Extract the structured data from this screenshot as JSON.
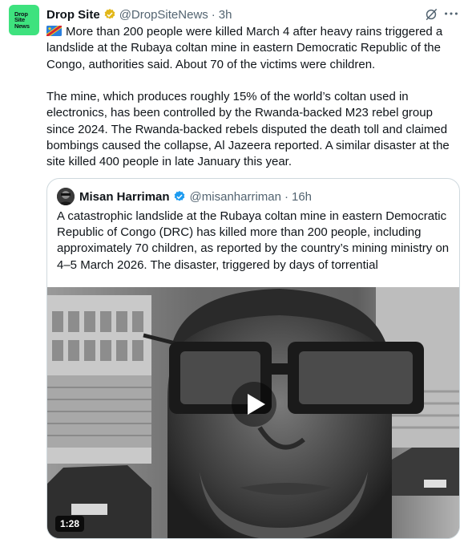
{
  "tweet": {
    "author_name": "Drop Site",
    "handle": "@DropSiteNews",
    "separator": "·",
    "time": "3h",
    "avatar_logo_text": [
      "Drop",
      "Site",
      "News"
    ],
    "paragraphs": [
      "More than 200 people were killed March 4 after heavy rains triggered a landslide at the Rubaya coltan mine in eastern Democratic Republic of the Congo, authorities said. About 70 of the victims were children.",
      "The mine, which produces roughly 15% of the world’s coltan used in electronics, has been controlled by the Rwanda-backed M23 rebel group since 2024. The Rwanda-backed rebels disputed the death toll and claimed bombings caused the collapse, Al Jazeera reported. A similar disaster at the site killed 400 people in late January this year."
    ]
  },
  "quoted": {
    "author_name": "Misan Harriman",
    "handle": "@misanharriman",
    "separator": "·",
    "time": "16h",
    "text": "A catastrophic landslide at the Rubaya coltan mine in eastern Democratic Republic of Congo (DRC) has killed more than 200 people, including approximately 70 children, as reported by the country’s mining ministry on 4–5 March 2026. The disaster, triggered by days of torrential",
    "video_duration": "1:28"
  },
  "icons": {
    "verified_business": "gold-check-badge-icon",
    "verified": "blue-check-badge-icon",
    "flag": "drc-flag-icon",
    "grok": "grok-icon",
    "more": "more-options-icon",
    "play": "play-icon"
  },
  "colors": {
    "avatar_bg": "#3ee27e",
    "gold_badge": "#e2b719",
    "blue_badge": "#1d9bf0",
    "secondary_text": "#536471",
    "border": "#cfd9de"
  }
}
